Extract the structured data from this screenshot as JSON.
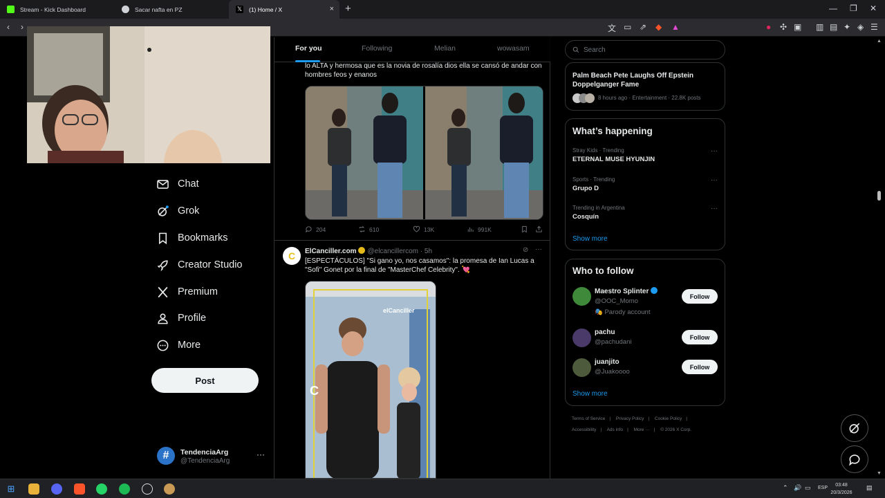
{
  "browser": {
    "tabs": [
      {
        "title": "Stream - Kick Dashboard",
        "favicon_color": "#53fc18"
      },
      {
        "title": "Sacar nafta en PZ",
        "favicon_color": "#cfd2d6"
      },
      {
        "title": "(1) Home / X",
        "favicon_color": "#ffffff"
      }
    ],
    "new_tab": "+",
    "close_tab": "×"
  },
  "feed_tabs": [
    "For you",
    "Following",
    "Melian",
    "wowasam"
  ],
  "nav": {
    "items": [
      {
        "label": "Chat",
        "icon": "envelope-icon"
      },
      {
        "label": "Grok",
        "icon": "grok-icon"
      },
      {
        "label": "Bookmarks",
        "icon": "bookmark-icon"
      },
      {
        "label": "Creator Studio",
        "icon": "rocket-icon"
      },
      {
        "label": "Premium",
        "icon": "x-logo-icon"
      },
      {
        "label": "Profile",
        "icon": "person-icon"
      },
      {
        "label": "More",
        "icon": "more-circle-icon"
      }
    ],
    "post_label": "Post"
  },
  "account": {
    "name": "TendenciaArg",
    "handle": "@TendenciaArg",
    "more": "···",
    "avatar_glyph": "#"
  },
  "tweet1": {
    "text": "lo ALTA y hermosa que es la novia de rosalía dios ella se cansó de andar con hombres feos y enanos",
    "replies": "204",
    "reposts": "610",
    "likes": "13K",
    "views": "991K"
  },
  "tweet2": {
    "avatar_glyph": "C",
    "name": "ElCanciller.com",
    "handle": "@elcancillercom",
    "time": "· 5h",
    "text": "[ESPECTÁCULOS] \"Si gano yo, nos casamos\": la promesa de Ian Lucas a \"Sofi\" Gonet por la final de \"MasterChef Celebrity\". 💘",
    "watermark": "elCanciller",
    "more": "···"
  },
  "search": {
    "placeholder": "Search"
  },
  "news": {
    "title": "Palm Beach Pete Laughs Off Epstein Doppelganger Fame",
    "meta": "8 hours ago · Entertainment · 22.8K posts"
  },
  "happening": {
    "title": "What’s happening",
    "trends": [
      {
        "meta": "Stray Kids · Trending",
        "name": "ETERNAL MUSE HYUNJIN"
      },
      {
        "meta": "Sports · Trending",
        "name": "Grupo D"
      },
      {
        "meta": "Trending in Argentina",
        "name": "Cosquín"
      }
    ],
    "show_more": "Show more",
    "more": "···"
  },
  "who_to_follow": {
    "title": "Who to follow",
    "users": [
      {
        "name": "Maestro Splinter",
        "handle": "@OOC_Momo",
        "extra": "🎭 Parody account",
        "button": "Follow"
      },
      {
        "name": "pachu",
        "handle": "@pachudani",
        "extra": "",
        "button": "Follow"
      },
      {
        "name": "juanjito",
        "handle": "@Juakoooo",
        "extra": "",
        "button": "Follow"
      }
    ],
    "show_more": "Show more"
  },
  "footer": {
    "links": [
      "Terms of Service",
      "|",
      "Privacy Policy",
      "|",
      "Cookie Policy",
      "|",
      "Accessibility",
      "|",
      "Ads info",
      "|",
      "More ···",
      "|",
      "© 2026 X Corp."
    ]
  },
  "taskbar": {
    "lang": "ESP",
    "time": "03:48",
    "date": "20/3/2026"
  },
  "colors": {
    "accent": "#1d9bf0",
    "background": "#000000",
    "border": "#2f3336",
    "muted": "#71767b"
  }
}
